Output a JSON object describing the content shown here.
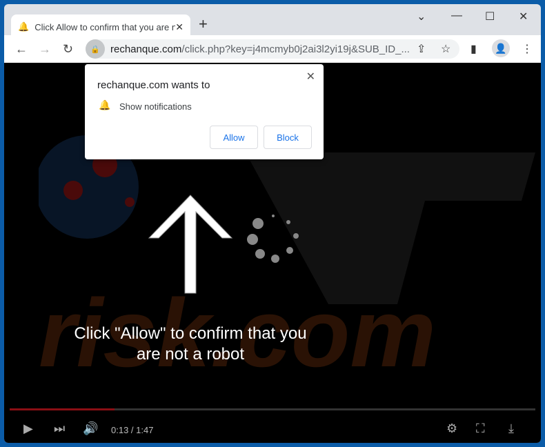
{
  "tab": {
    "title": "Click Allow to confirm that you are not a robot",
    "icon": "bell-tab-icon"
  },
  "toolbar": {
    "url_domain": "rechanque.com",
    "url_path": "/click.php?key=j4mcmyb0j2ai3l2yi19j&SUB_ID_..."
  },
  "popup": {
    "heading": "rechanque.com wants to",
    "permission": "Show notifications",
    "allow": "Allow",
    "block": "Block"
  },
  "page": {
    "message_line1": "Click \"Allow\" to confirm that you",
    "message_line2": "are not a robot"
  },
  "player": {
    "time": "0:13 / 1:47",
    "progress_fraction": 0.2,
    "progress_color": "#8b0f14"
  }
}
